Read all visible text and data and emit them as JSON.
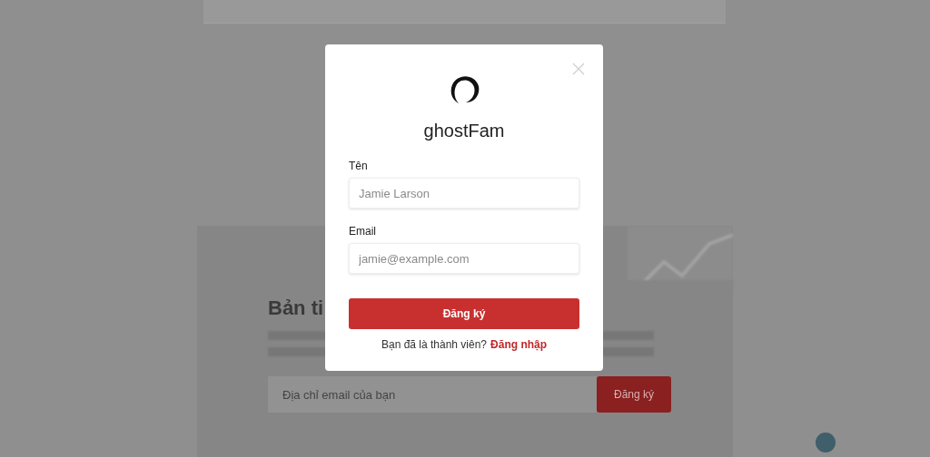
{
  "background": {
    "newsletter": {
      "heading": "Bản ti",
      "email_field": {
        "placeholder": "Địa chỉ email của bạn"
      },
      "submit_button": "Đăng ký"
    }
  },
  "modal": {
    "brand": "ghostFam",
    "fields": [
      {
        "label": "Tên",
        "placeholder": "Jamie Larson"
      },
      {
        "label": "Email",
        "placeholder": "jamie@example.com"
      }
    ],
    "submit_button": "Đăng ký",
    "footer_text": "Bạn đã là thành viên?",
    "footer_link": "Đăng nhập"
  }
}
